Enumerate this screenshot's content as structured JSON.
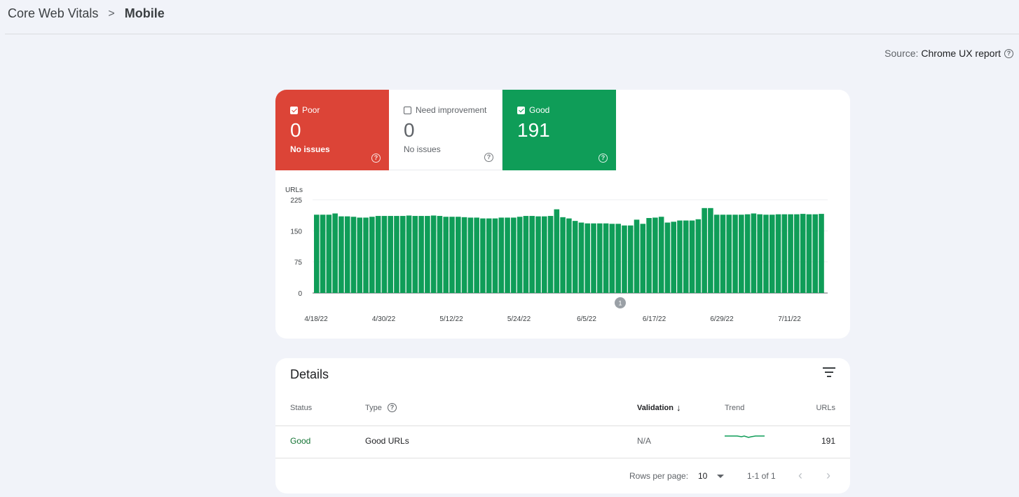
{
  "breadcrumb": {
    "parent": "Core Web Vitals",
    "separator": ">",
    "current": "Mobile"
  },
  "source": {
    "label": "Source:",
    "value": "Chrome UX report",
    "help": "?"
  },
  "tiles": [
    {
      "id": "poor",
      "label": "Poor",
      "checked": true,
      "count": "0",
      "sub": "No issues",
      "color": "#dc4437"
    },
    {
      "id": "need",
      "label": "Need improvement",
      "checked": false,
      "count": "0",
      "sub": "No issues",
      "color": "#5f6368"
    },
    {
      "id": "good",
      "label": "Good",
      "checked": true,
      "count": "191",
      "sub": "",
      "color": "#0f9d58"
    }
  ],
  "chart_data": {
    "type": "bar",
    "ylabel": "URLs",
    "ylim": [
      0,
      225
    ],
    "yticks": [
      0,
      75,
      150,
      225
    ],
    "xtick_labels": [
      "4/18/22",
      "4/30/22",
      "5/12/22",
      "5/24/22",
      "6/5/22",
      "6/17/22",
      "6/29/22",
      "7/11/22"
    ],
    "annotation": "1",
    "series": [
      {
        "name": "Good",
        "color": "#0f9d58",
        "values": [
          189,
          189,
          189,
          192,
          185,
          185,
          184,
          182,
          182,
          184,
          186,
          186,
          186,
          186,
          186,
          187,
          186,
          186,
          186,
          187,
          186,
          184,
          184,
          184,
          183,
          182,
          182,
          180,
          180,
          180,
          182,
          182,
          182,
          184,
          186,
          186,
          185,
          185,
          186,
          202,
          183,
          180,
          174,
          170,
          168,
          168,
          168,
          168,
          167,
          167,
          163,
          163,
          177,
          167,
          181,
          182,
          184,
          170,
          172,
          175,
          175,
          175,
          178,
          205,
          205,
          189,
          189,
          189,
          189,
          189,
          190,
          192,
          190,
          189,
          189,
          190,
          190,
          190,
          190,
          191,
          190,
          190,
          191
        ]
      }
    ]
  },
  "details": {
    "title": "Details",
    "columns": {
      "status": "Status",
      "type": "Type",
      "validation": "Validation",
      "trend": "Trend",
      "urls": "URLs"
    },
    "rows": [
      {
        "status": "Good",
        "type": "Good URLs",
        "validation": "N/A",
        "urls": "191"
      }
    ],
    "pagination": {
      "rows_label": "Rows per page:",
      "rows_value": "10",
      "range": "1-1 of 1"
    }
  }
}
